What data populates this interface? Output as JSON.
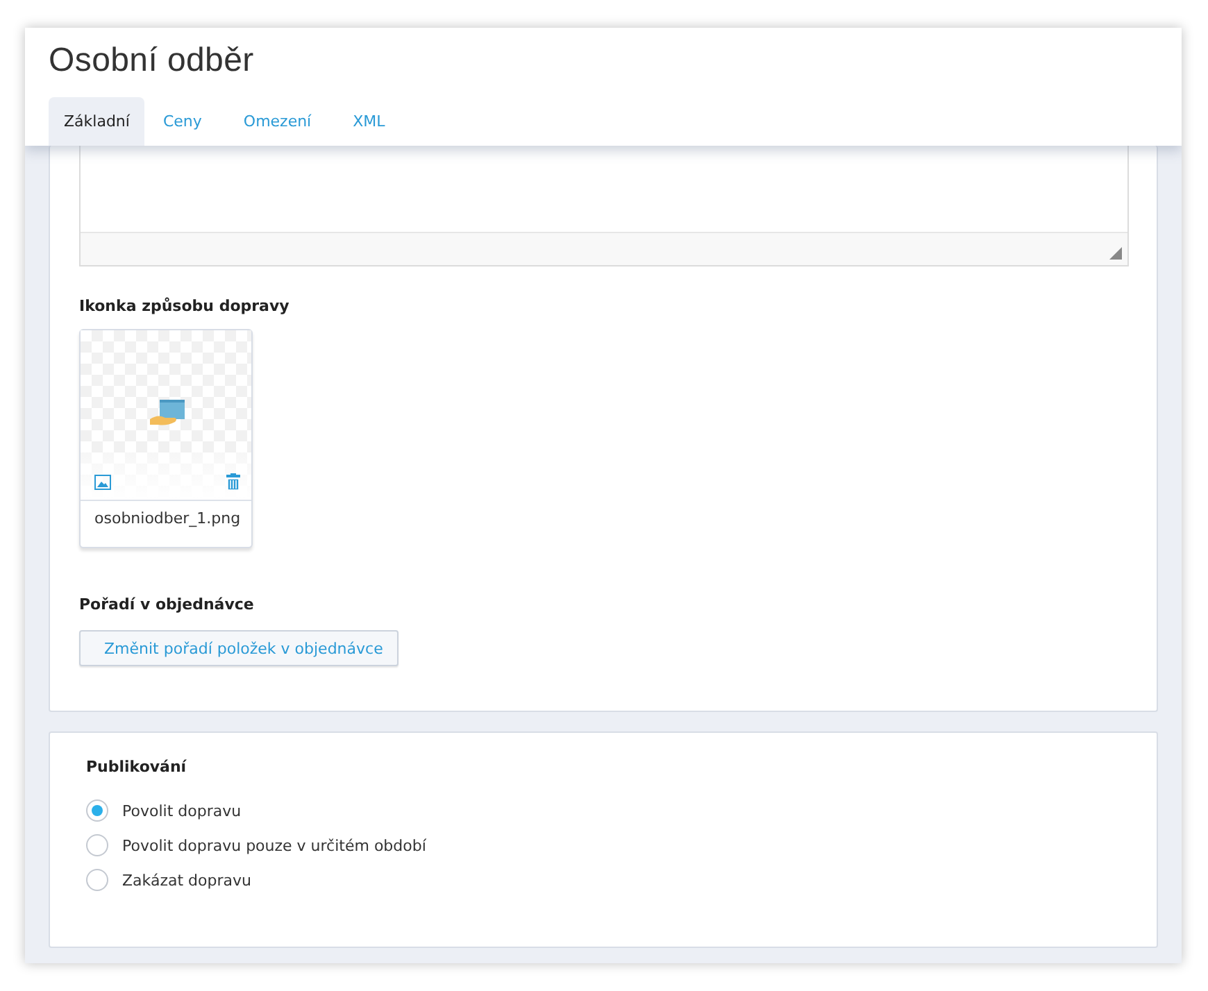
{
  "window": {
    "title": "Osobní odběr"
  },
  "tabs": [
    {
      "label": "Základní",
      "selected": true
    },
    {
      "label": "Ceny",
      "selected": false
    },
    {
      "label": "Omezení",
      "selected": false
    },
    {
      "label": "XML",
      "selected": false
    }
  ],
  "icon_section": {
    "heading": "Ikonka způsobu dopravy",
    "file_name": "osobniodber_1.png"
  },
  "order_section": {
    "heading": "Pořadí v objednávce",
    "button": "Změnit pořadí položek v objednávce"
  },
  "publishing": {
    "heading": "Publikování",
    "options": [
      {
        "label": "Povolit dopravu",
        "selected": true
      },
      {
        "label": "Povolit dopravu pouze v určitém období",
        "selected": false
      },
      {
        "label": "Zakázat dopravu",
        "selected": false
      }
    ]
  }
}
